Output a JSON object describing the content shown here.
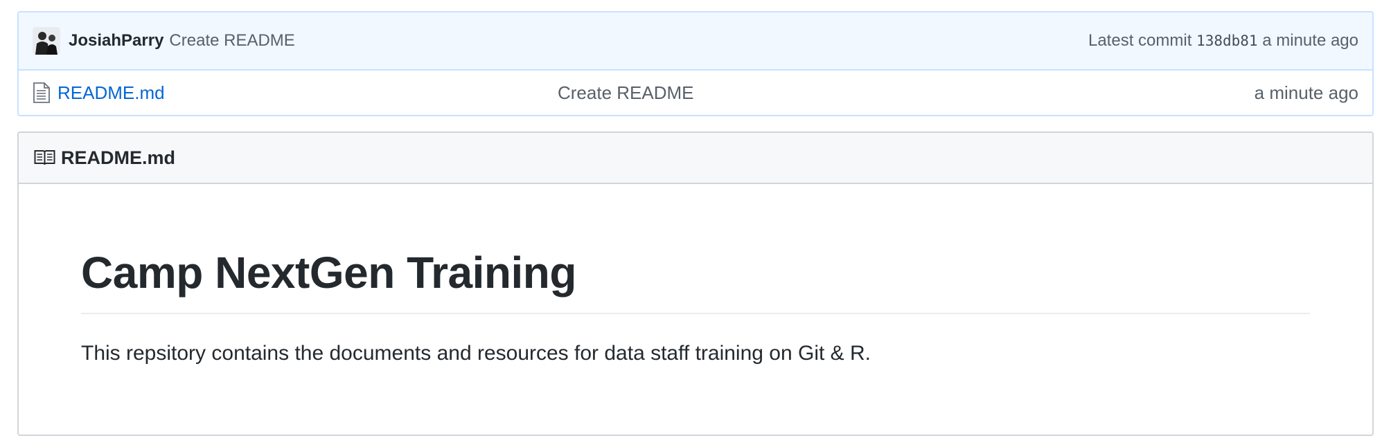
{
  "commit": {
    "author": "JosiahParry",
    "message": "Create README",
    "latest_label": "Latest commit",
    "sha": "138db81",
    "age": "a minute ago"
  },
  "files": [
    {
      "name": "README.md",
      "message": "Create README",
      "age": "a minute ago",
      "icon": "file-text-icon"
    }
  ],
  "readme": {
    "header_title": "README.md",
    "header_icon": "book-icon",
    "heading": "Camp NextGen Training",
    "paragraph": "This repsitory contains the documents and resources for data staff training on Git & R."
  },
  "colors": {
    "link": "#0366d6",
    "commit_bg": "#f1f8ff",
    "commit_border": "#c8e1ff",
    "muted_text": "#586069"
  }
}
